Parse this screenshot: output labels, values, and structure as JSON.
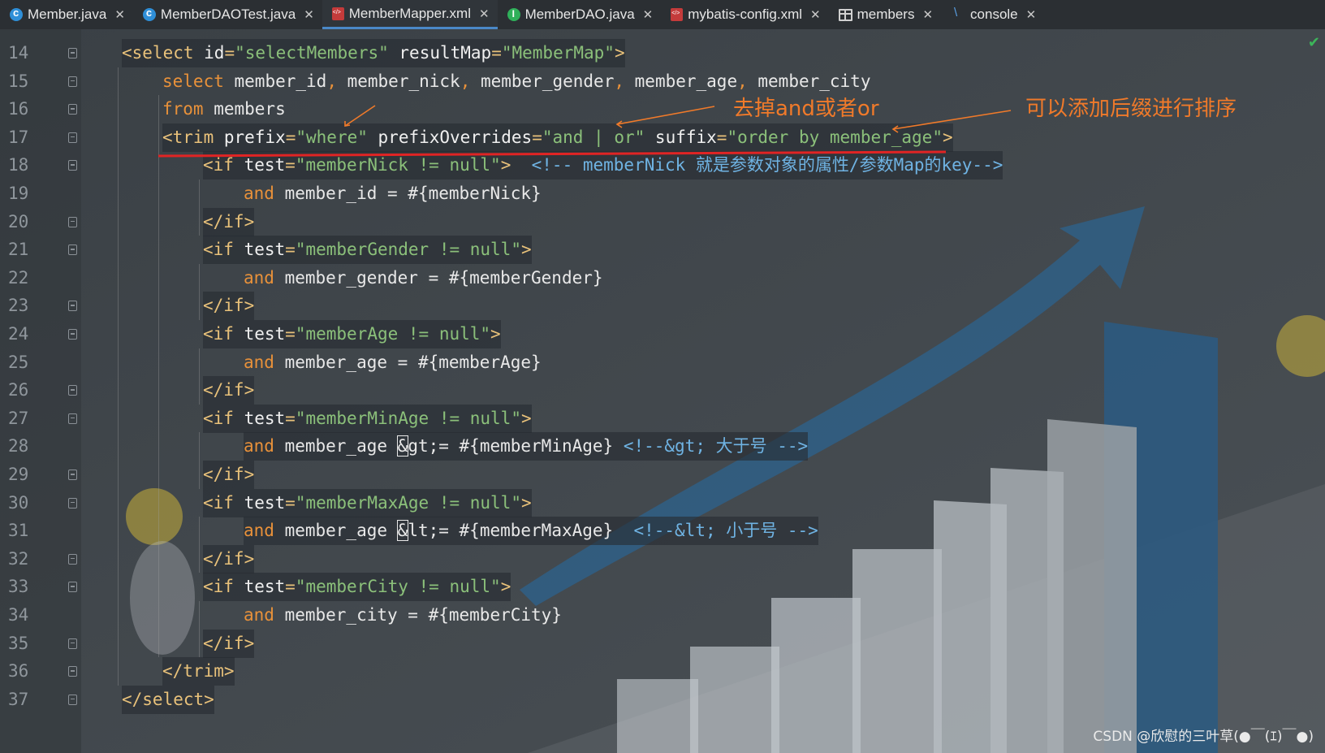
{
  "tabs": [
    {
      "label": "Member.java",
      "icon": "class-icon",
      "active": false
    },
    {
      "label": "MemberDAOTest.java",
      "icon": "class-icon",
      "active": false
    },
    {
      "label": "MemberMapper.xml",
      "icon": "xml-icon",
      "active": true
    },
    {
      "label": "MemberDAO.java",
      "icon": "interface-icon",
      "active": false
    },
    {
      "label": "mybatis-config.xml",
      "icon": "xml-icon",
      "active": false
    },
    {
      "label": "members",
      "icon": "table-icon",
      "active": false
    },
    {
      "label": "console",
      "icon": "console-icon",
      "active": false
    }
  ],
  "line_numbers": [
    "14",
    "15",
    "16",
    "17",
    "18",
    "19",
    "20",
    "21",
    "22",
    "23",
    "24",
    "25",
    "26",
    "27",
    "28",
    "29",
    "30",
    "31",
    "32",
    "33",
    "34",
    "35",
    "36",
    "37"
  ],
  "code_lines": [
    [
      [
        "t",
        "<select "
      ],
      [
        "a",
        "id"
      ],
      [
        "t",
        "="
      ],
      [
        "s",
        "\"selectMembers\""
      ],
      [
        "a",
        " resultMap"
      ],
      [
        "t",
        "="
      ],
      [
        "s",
        "\"MemberMap\""
      ],
      [
        "t",
        ">"
      ]
    ],
    [
      [
        "k",
        "select "
      ],
      [
        "p",
        "member_id"
      ],
      [
        "k",
        ", "
      ],
      [
        "p",
        "member_nick"
      ],
      [
        "k",
        ", "
      ],
      [
        "p",
        "member_gender"
      ],
      [
        "k",
        ", "
      ],
      [
        "p",
        "member_age"
      ],
      [
        "k",
        ", "
      ],
      [
        "p",
        "member_city"
      ]
    ],
    [
      [
        "k",
        "from "
      ],
      [
        "p",
        "members"
      ]
    ],
    [
      [
        "t",
        "<trim "
      ],
      [
        "a",
        "prefix"
      ],
      [
        "t",
        "="
      ],
      [
        "s",
        "\"where\""
      ],
      [
        "a",
        " prefixOverrides"
      ],
      [
        "t",
        "="
      ],
      [
        "s",
        "\"and | or\""
      ],
      [
        "a",
        " suffix"
      ],
      [
        "t",
        "="
      ],
      [
        "s",
        "\"order by member_age\""
      ],
      [
        "t",
        ">"
      ]
    ],
    [
      [
        "t",
        "<if "
      ],
      [
        "a",
        "test"
      ],
      [
        "t",
        "="
      ],
      [
        "s",
        "\"memberNick != null\""
      ],
      [
        "t",
        ">"
      ],
      [
        "p",
        "  "
      ],
      [
        "cm",
        "<!-- memberNick 就是参数对象的属性/参数Map的key-->"
      ]
    ],
    [
      [
        "k",
        "and "
      ],
      [
        "p",
        "member_id = #{memberNick}"
      ]
    ],
    [
      [
        "t",
        "</if>"
      ]
    ],
    [
      [
        "t",
        "<if "
      ],
      [
        "a",
        "test"
      ],
      [
        "t",
        "="
      ],
      [
        "s",
        "\"memberGender != null\""
      ],
      [
        "t",
        ">"
      ]
    ],
    [
      [
        "k",
        "and "
      ],
      [
        "p",
        "member_gender = #{memberGender}"
      ]
    ],
    [
      [
        "t",
        "</if>"
      ]
    ],
    [
      [
        "t",
        "<if "
      ],
      [
        "a",
        "test"
      ],
      [
        "t",
        "="
      ],
      [
        "s",
        "\"memberAge != null\""
      ],
      [
        "t",
        ">"
      ]
    ],
    [
      [
        "k",
        "and "
      ],
      [
        "p",
        "member_age = #{memberAge}"
      ]
    ],
    [
      [
        "t",
        "</if>"
      ]
    ],
    [
      [
        "t",
        "<if "
      ],
      [
        "a",
        "test"
      ],
      [
        "t",
        "="
      ],
      [
        "s",
        "\"memberMinAge != null\""
      ],
      [
        "t",
        ">"
      ]
    ],
    [
      [
        "k",
        "and "
      ],
      [
        "p",
        "member_age "
      ],
      [
        "c",
        "&"
      ],
      [
        "p",
        "gt;= #{memberMinAge} "
      ],
      [
        "cm",
        "<!--&gt; 大于号 -->"
      ]
    ],
    [
      [
        "t",
        "</if>"
      ]
    ],
    [
      [
        "t",
        "<if "
      ],
      [
        "a",
        "test"
      ],
      [
        "t",
        "="
      ],
      [
        "s",
        "\"memberMaxAge != null\""
      ],
      [
        "t",
        ">"
      ]
    ],
    [
      [
        "k",
        "and "
      ],
      [
        "p",
        "member_age "
      ],
      [
        "c",
        "&"
      ],
      [
        "p",
        "lt;= #{memberMaxAge}  "
      ],
      [
        "cm",
        "<!--&lt; 小于号 -->"
      ]
    ],
    [
      [
        "t",
        "</if>"
      ]
    ],
    [
      [
        "t",
        "<if "
      ],
      [
        "a",
        "test"
      ],
      [
        "t",
        "="
      ],
      [
        "s",
        "\"memberCity != null\""
      ],
      [
        "t",
        ">"
      ]
    ],
    [
      [
        "k",
        "and "
      ],
      [
        "p",
        "member_city = #{memberCity}"
      ]
    ],
    [
      [
        "t",
        "</if>"
      ]
    ],
    [
      [
        "t",
        "</trim>"
      ]
    ],
    [
      [
        "t",
        "</select>"
      ]
    ]
  ],
  "annotations": {
    "remove_and_or": "去掉and或者or",
    "add_suffix_sort": "可以添加后缀进行排序"
  },
  "watermark": "CSDN @欣慰的三叶草(●￣(ｴ)￣●)",
  "colors": {
    "tag": "#e8c17a",
    "attr": "#f0f0f0",
    "string": "#8bc07a",
    "keyword": "#e8913a",
    "comment": "#6fb3e3",
    "annotation": "#f07a2a",
    "underline": "#e02424",
    "active_tab": "#4a88c7"
  }
}
